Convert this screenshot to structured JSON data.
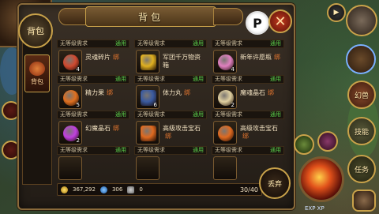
{
  "window": {
    "title": "背包",
    "tab_label": "背包",
    "side_tab_label": "背包"
  },
  "items": [
    {
      "req": "无等级需求",
      "status": "通用",
      "name": "灵魂碎片",
      "tag": "绑",
      "count": "4",
      "color": "#d04a30"
    },
    {
      "req": "无等级需求",
      "status": "通用",
      "name": "军团千万物资箱",
      "tag": "",
      "count": "",
      "color": "#e0b020"
    },
    {
      "req": "无等级需求",
      "status": "通用",
      "name": "新年许愿瓶",
      "tag": "绑",
      "count": "4",
      "color": "#e080c0"
    },
    {
      "req": "无等级需求",
      "status": "通用",
      "name": "精力果",
      "tag": "绑",
      "count": "5",
      "color": "#e07020"
    },
    {
      "req": "无等级需求",
      "status": "通用",
      "name": "体力丸",
      "tag": "绑",
      "count": "6",
      "color": "#3a5aa0"
    },
    {
      "req": "无等级需求",
      "status": "通用",
      "name": "魔魂晶石",
      "tag": "绑",
      "count": "2",
      "color": "#e0d0a0"
    },
    {
      "req": "无等级需求",
      "status": "通用",
      "name": "幻魔晶石",
      "tag": "绑",
      "count": "2",
      "color": "#c040e0"
    },
    {
      "req": "无等级需求",
      "status": "通用",
      "name": "高级攻击宝石",
      "tag": "绑",
      "count": "",
      "color": "#e06a20"
    },
    {
      "req": "无等级需求",
      "status": "通用",
      "name": "高级攻击宝石",
      "tag": "绑",
      "count": "",
      "color": "#e06a20"
    },
    {
      "req": "无等级需求",
      "status": "通用",
      "name": "",
      "tag": "",
      "count": "",
      "color": ""
    },
    {
      "req": "无等级需求",
      "status": "通用",
      "name": "",
      "tag": "",
      "count": "",
      "color": ""
    },
    {
      "req": "无等级需求",
      "status": "通用",
      "name": "",
      "tag": "",
      "count": "",
      "color": ""
    }
  ],
  "status": {
    "gold": "367,292",
    "diamond": "306",
    "ingot": "0",
    "capacity": "30/40"
  },
  "buttons": {
    "discard": "丢弃",
    "close": "✕",
    "p": "P"
  },
  "hud": {
    "play": "▶",
    "illusion": "幻兽",
    "skill": "技能",
    "quest": "任务",
    "exp": "EXP XP"
  }
}
